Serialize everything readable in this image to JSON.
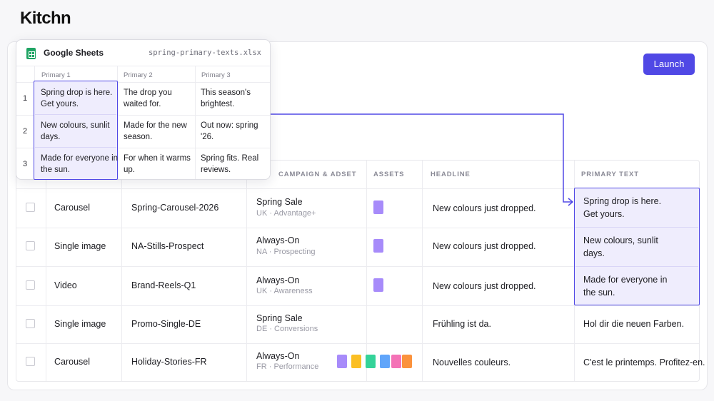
{
  "app": {
    "logo": "Kitchn"
  },
  "toolbar": {
    "launch_label": "Launch"
  },
  "sheet": {
    "app_name": "Google Sheets",
    "file_name": "spring-primary-texts.xlsx",
    "columns": [
      "Primary 1",
      "Primary 2",
      "Primary 3"
    ],
    "rows": [
      {
        "num": "1",
        "cells": [
          "Spring drop is here.\nGet yours.",
          "The drop you\nwaited for.",
          "This season's\nbrightest."
        ]
      },
      {
        "num": "2",
        "cells": [
          "New colours, sunlit\ndays.",
          "Made for the new\nseason.",
          "Out now: spring\n'26."
        ]
      },
      {
        "num": "3",
        "cells": [
          "Made for everyone in\nthe sun.",
          "For when it warms\nup.",
          "Spring fits. Real\nreviews."
        ]
      }
    ]
  },
  "table": {
    "headers": {
      "campaign": "CAMPAIGN & ADSET",
      "assets": "ASSETS",
      "headline": "HEADLINE",
      "primary": "PRIMARY TEXT"
    },
    "rows": [
      {
        "format": "Carousel",
        "name": "Spring-Carousel-2026",
        "campaign": "Spring Sale",
        "adset": "UK · Advantage+",
        "headline": "New colours just dropped.",
        "primary": "Spring drop is here.\nGet yours."
      },
      {
        "format": "Single image",
        "name": "NA-Stills-Prospect",
        "campaign": "Always-On",
        "adset": "NA · Prospecting",
        "headline": "New colours just dropped.",
        "primary": "New colours, sunlit\ndays."
      },
      {
        "format": "Video",
        "name": "Brand-Reels-Q1",
        "campaign": "Always-On",
        "adset": "UK · Awareness",
        "headline": "New colours just dropped.",
        "primary": "Made for everyone in\nthe sun."
      },
      {
        "format": "Single image",
        "name": "Promo-Single-DE",
        "campaign": "Spring Sale",
        "adset": "DE · Conversions",
        "headline": "Frühling ist da.",
        "primary": "Hol dir die neuen Farben."
      },
      {
        "format": "Carousel",
        "name": "Holiday-Stories-FR",
        "campaign": "Always-On",
        "adset": "FR · Performance",
        "headline": "Nouvelles couleurs.",
        "primary": "C'est le printemps. Profitez-en."
      }
    ]
  },
  "colors": {
    "accent": "#5048e5",
    "highlight_fill": "#efedfd",
    "asset_swatches": [
      "#a78bfa",
      "#fbbf24",
      "#34d399",
      "#60a5fa",
      "#f472b6",
      "#fb923c"
    ]
  }
}
